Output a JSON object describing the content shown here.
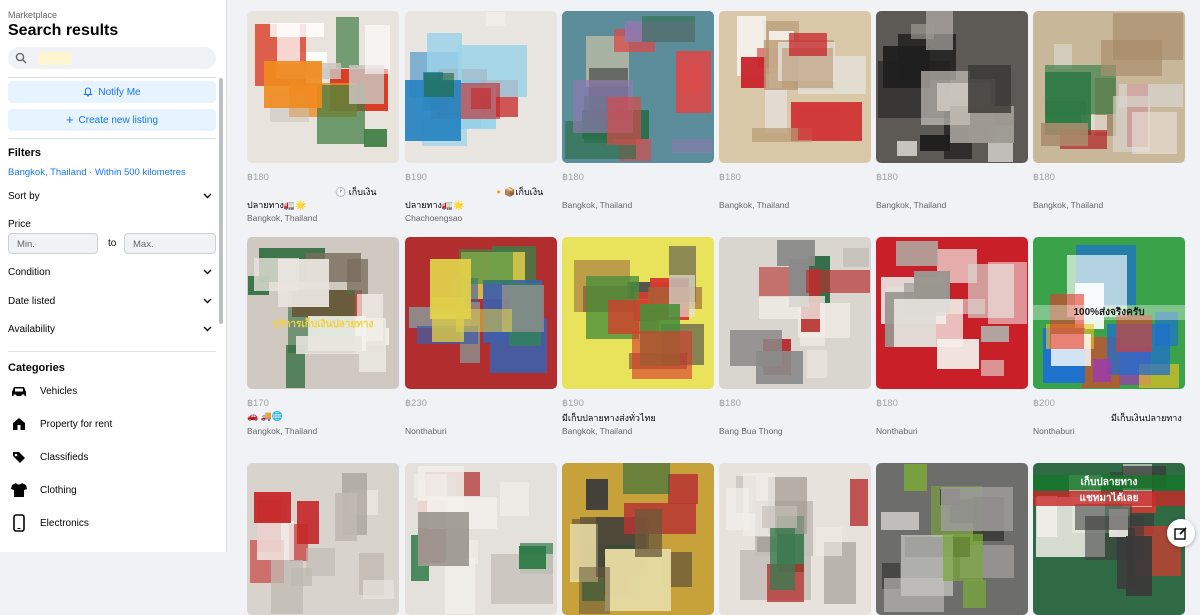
{
  "sidebar": {
    "breadcrumb": "Marketplace",
    "title": "Search results",
    "search_value": "",
    "notify_label": "Notify Me",
    "create_label": "Create new listing",
    "filters_heading": "Filters",
    "location": "Bangkok, Thailand · Within 500 kilometres",
    "sort_label": "Sort by",
    "price_label": "Price",
    "min_placeholder": "Min.",
    "to_label": "to",
    "max_placeholder": "Max.",
    "condition_label": "Condition",
    "date_label": "Date listed",
    "availability_label": "Availability",
    "categories_heading": "Categories",
    "categories": [
      {
        "label": "Vehicles",
        "icon": "car-icon"
      },
      {
        "label": "Property for rent",
        "icon": "house-icon"
      },
      {
        "label": "Classifieds",
        "icon": "tag-icon"
      },
      {
        "label": "Clothing",
        "icon": "shirt-icon"
      },
      {
        "label": "Electronics",
        "icon": "phone-icon"
      }
    ]
  },
  "listings": [
    {
      "price": "฿180",
      "desc": "ปลายทาง🚛🌟",
      "desc_tail": "🕐 เก็บเงิน",
      "location": "Bangkok, Thailand"
    },
    {
      "price": "฿190",
      "desc": "ปลายทาง🚛🌟",
      "desc_tail": "🔸📦เก็บเงิน",
      "location": "Chachoengsao"
    },
    {
      "price": "฿180",
      "desc": "",
      "desc_tail": "",
      "location": "Bangkok, Thailand"
    },
    {
      "price": "฿180",
      "desc": "",
      "desc_tail": "",
      "location": "Bangkok, Thailand"
    },
    {
      "price": "฿180",
      "desc": "",
      "desc_tail": "",
      "location": "Bangkok, Thailand"
    },
    {
      "price": "฿180",
      "desc": "",
      "desc_tail": "",
      "location": "Bangkok, Thailand"
    },
    {
      "price": "฿170",
      "desc": "🚗 🚚🌐",
      "desc_tail": "",
      "location": "Bangkok, Thailand"
    },
    {
      "price": "฿230",
      "desc": "",
      "desc_tail": "",
      "location": "Nonthaburi"
    },
    {
      "price": "฿190",
      "desc": "มีเก็บปลายทางส่งทั่วไทย",
      "desc_tail": "",
      "location": "Bangkok, Thailand"
    },
    {
      "price": "฿180",
      "desc": "",
      "desc_tail": "",
      "location": "Bang Bua Thong"
    },
    {
      "price": "฿180",
      "desc": "",
      "desc_tail": "",
      "location": "Nonthaburi"
    },
    {
      "price": "฿200",
      "desc": "",
      "desc_tail": "มีเก็บเงินปลายทาง",
      "location": "Nonthaburi"
    }
  ],
  "overlay_texts": {
    "r2c1": "บริการเก็บเงินปลายทาง",
    "r2c6": "100%ส่งจริงครับ",
    "r3c6a": "เก็บปลายทาง",
    "r3c6b": "แชทมาได้เลย"
  },
  "colors": {
    "accent": "#1877f2",
    "accent_bg": "#e7f3ff",
    "page_bg": "#f0f2f5"
  }
}
